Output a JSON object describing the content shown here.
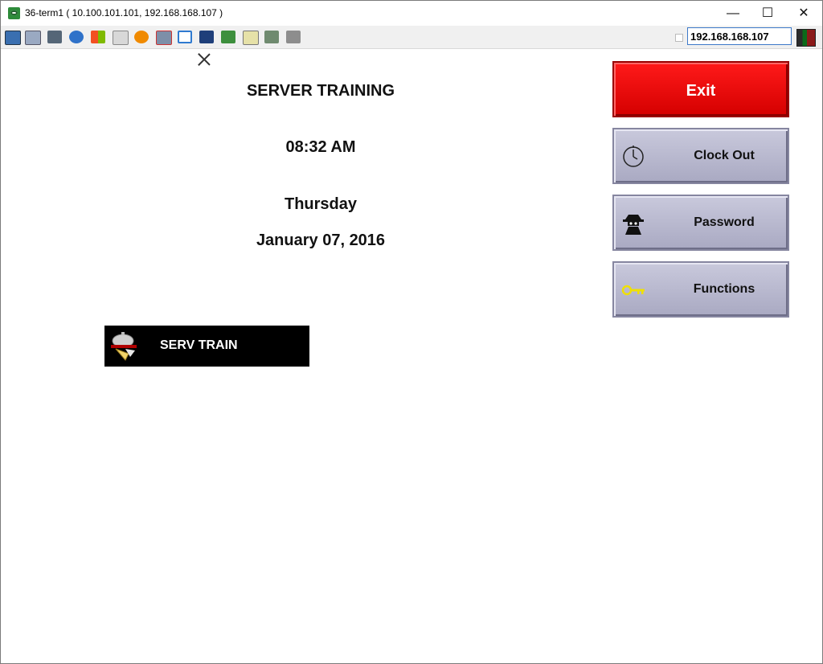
{
  "window": {
    "title": "36-term1 ( 10.100.101.101, 192.168.168.107 )",
    "controls": {
      "minimize": "—",
      "maximize": "☐",
      "close": "✕"
    }
  },
  "toolbar": {
    "ip_address": "192.168.168.107",
    "icons": [
      "monitor-icon",
      "windows-icon",
      "tools-icon",
      "refresh-icon",
      "windows-logo-icon",
      "keyboard-icon",
      "alert-icon",
      "network-icon",
      "fullscreen-icon",
      "display-icon",
      "download-icon",
      "note-icon",
      "frame-icon",
      "chat-icon"
    ]
  },
  "main": {
    "title": "SERVER TRAINING",
    "time": "08:32 AM",
    "day": "Thursday",
    "date": "January 07, 2016",
    "server_button": "SERV TRAIN"
  },
  "side_buttons": {
    "exit": "Exit",
    "clock_out": "Clock Out",
    "password": "Password",
    "functions": "Functions"
  },
  "colors": {
    "exit_red": "#e00000",
    "button_gray": "#b8b8cc",
    "key_yellow": "#f0e000"
  }
}
